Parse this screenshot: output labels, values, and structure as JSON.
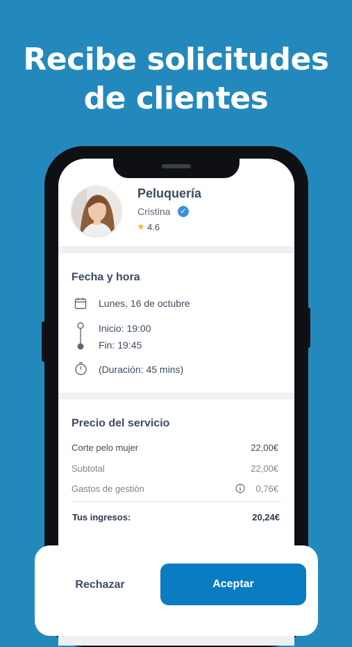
{
  "headline": {
    "line1": "Recibe solicitudes",
    "line2": "de clientes"
  },
  "profile": {
    "business": "Peluquería",
    "person": "Cristina",
    "verified": "✓",
    "rating": "4.6",
    "star": "★"
  },
  "date_section": {
    "title": "Fecha y hora",
    "date": "Lunes, 16 de octubre",
    "start": "Inicio: 19:00",
    "end": "Fin: 19:45",
    "duration": "(Duración: 45 mins)"
  },
  "price_section": {
    "title": "Precio del servicio",
    "rows": [
      {
        "label": "Corte pelo mujer",
        "value": "22,00€"
      },
      {
        "label": "Subtotal",
        "value": "22,00€"
      },
      {
        "label": "Gastos de gestión",
        "value": "0,76€"
      }
    ],
    "total": {
      "label": "Tus ingresos:",
      "value": "20,24€"
    }
  },
  "actions": {
    "reject": "Rechazar",
    "accept": "Aceptar"
  },
  "colors": {
    "background": "#2389bd",
    "accent": "#0a7cc1",
    "text": "#3b4b63",
    "star": "#f3b81a"
  }
}
